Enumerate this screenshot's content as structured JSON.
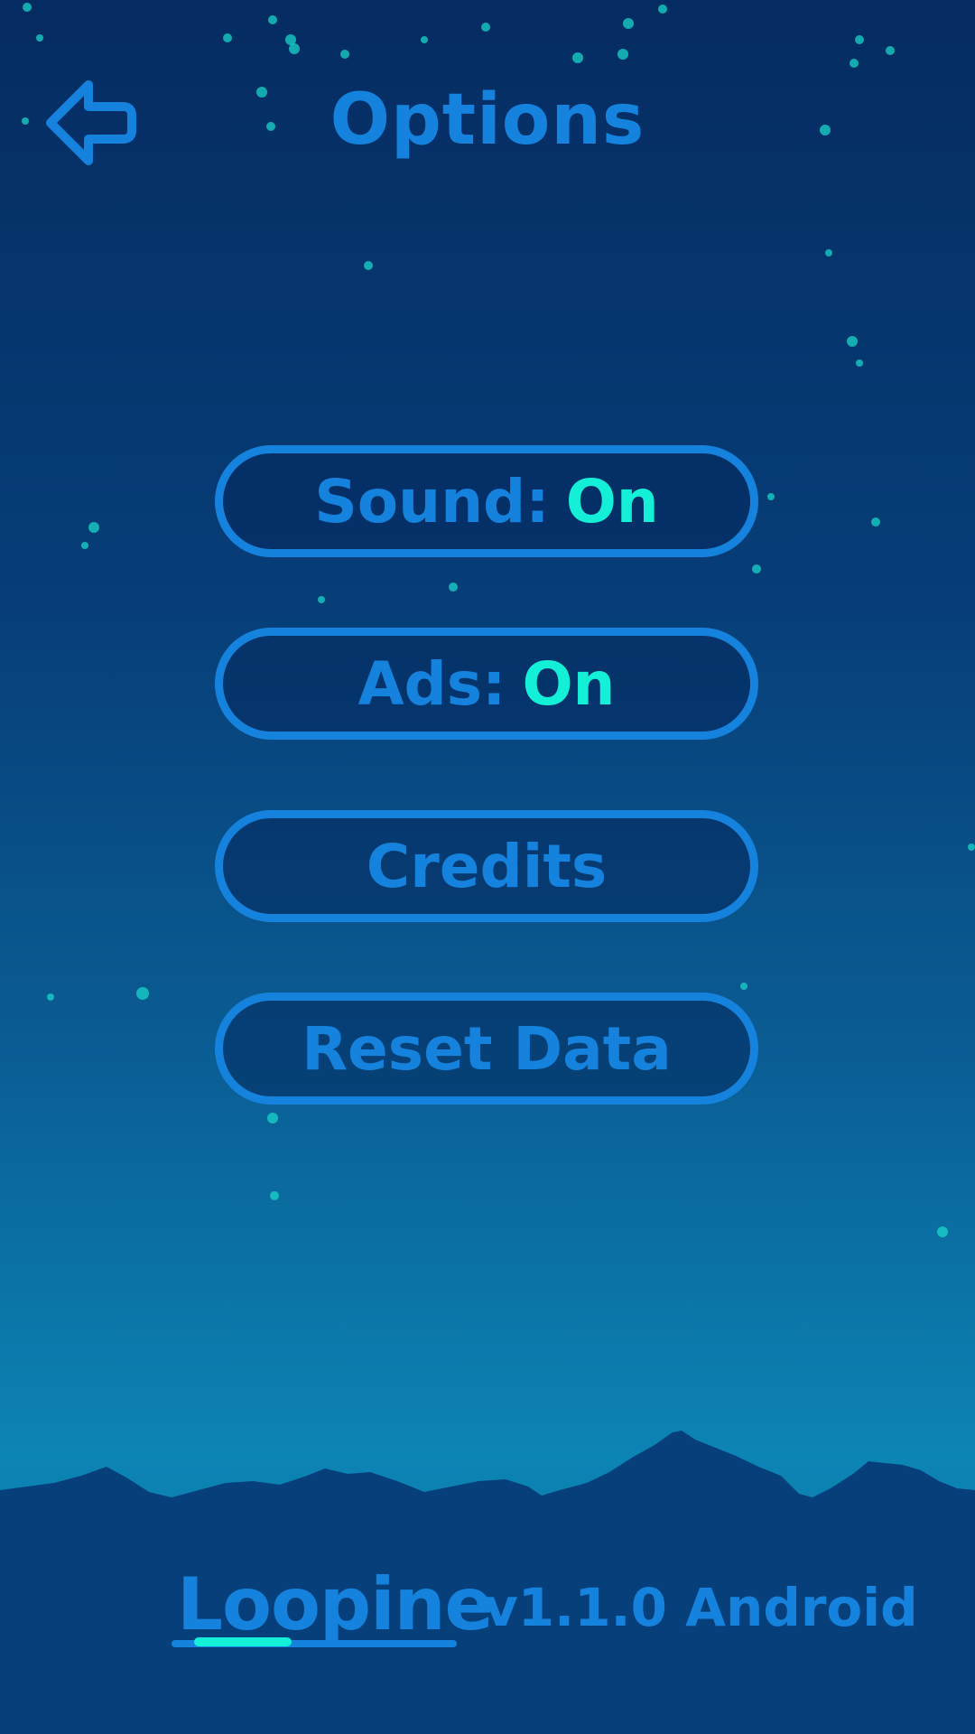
{
  "header": {
    "title": "Options",
    "back_icon": "back-arrow-icon"
  },
  "menu": {
    "sound": {
      "label": "Sound:",
      "value": "On"
    },
    "ads": {
      "label": "Ads:",
      "value": "On"
    },
    "credits": {
      "label": "Credits"
    },
    "reset": {
      "label": "Reset Data"
    }
  },
  "footer": {
    "logo_text": "Loopine",
    "version": "v1.1.0 Android"
  },
  "colors": {
    "accent": "#1583dd",
    "highlight": "#14f0d8",
    "background_top": "#052c62",
    "background_bottom": "#0c84b4",
    "mountains": "#063f7a"
  }
}
